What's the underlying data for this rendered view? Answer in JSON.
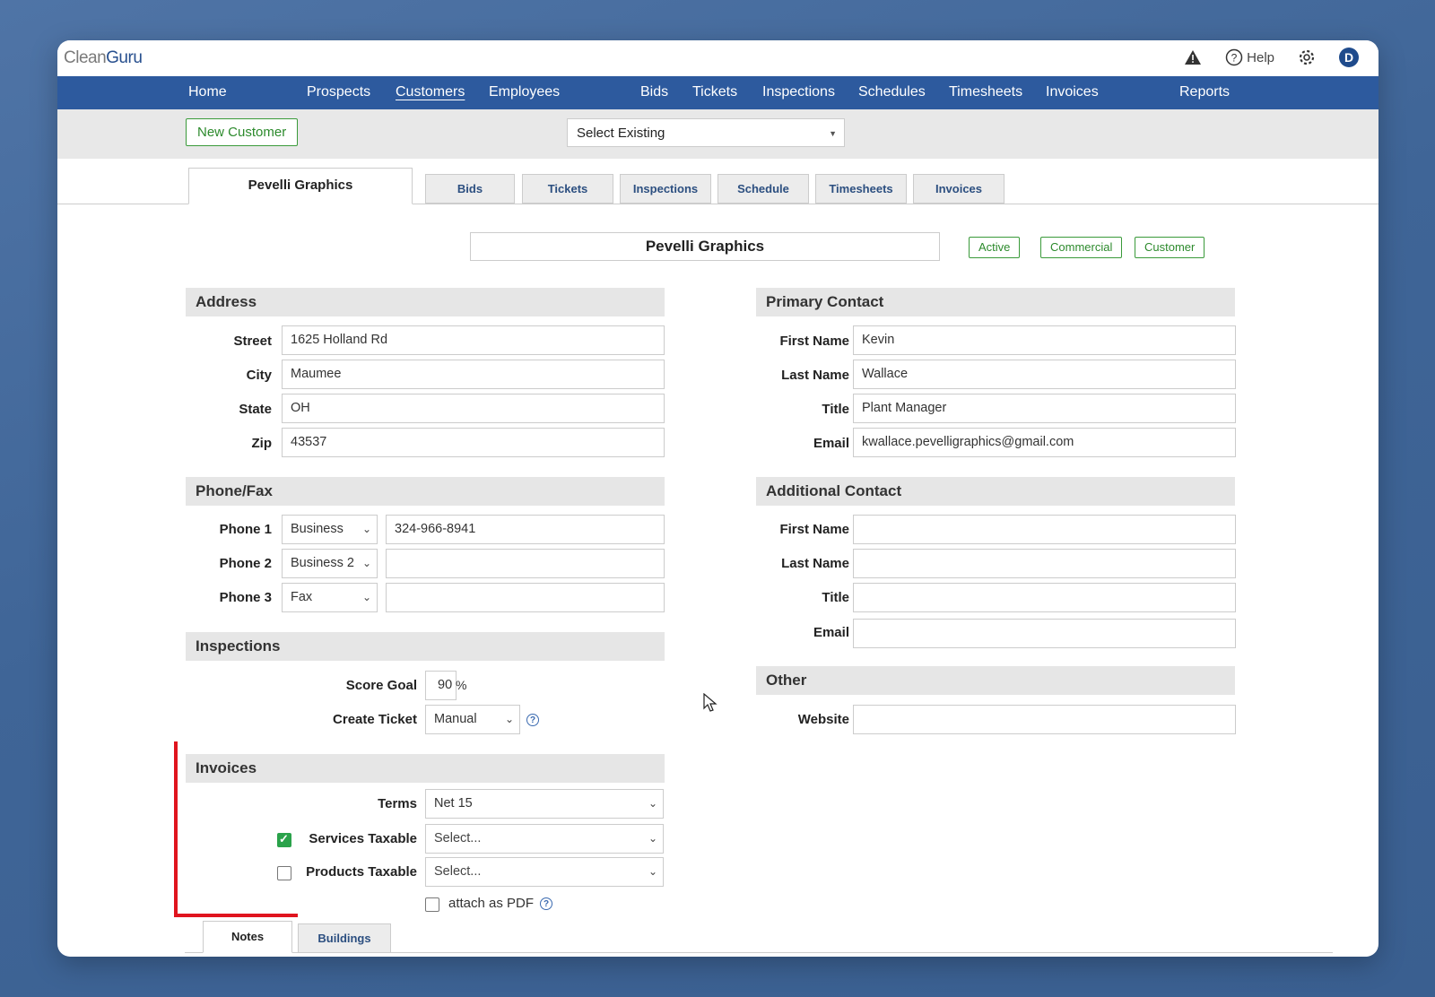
{
  "app": {
    "logo_clean": "Clean",
    "logo_guru": "Guru",
    "help_label": "Help",
    "user_initial": "D"
  },
  "nav": [
    "Home",
    "Prospects",
    "Customers",
    "Employees",
    "Bids",
    "Tickets",
    "Inspections",
    "Schedules",
    "Timesheets",
    "Invoices",
    "Reports"
  ],
  "nav_active": "Customers",
  "toolbar": {
    "new_customer": "New Customer",
    "select_existing": "Select Existing"
  },
  "tabs": {
    "main": "Pevelli Graphics",
    "others": [
      "Bids",
      "Tickets",
      "Inspections",
      "Schedule",
      "Timesheets",
      "Invoices"
    ]
  },
  "customer": {
    "name": "Pevelli Graphics",
    "badges": [
      "Active",
      "Commercial",
      "Customer"
    ]
  },
  "address": {
    "title": "Address",
    "street_label": "Street",
    "street": "1625 Holland Rd",
    "city_label": "City",
    "city": "Maumee",
    "state_label": "State",
    "state": "OH",
    "zip_label": "Zip",
    "zip": "43537"
  },
  "phone": {
    "title": "Phone/Fax",
    "p1_label": "Phone 1",
    "p1_type": "Business",
    "p1_value": "324-966-8941",
    "p2_label": "Phone 2",
    "p2_type": "Business 2",
    "p2_value": "",
    "p3_label": "Phone 3",
    "p3_type": "Fax",
    "p3_value": ""
  },
  "inspections": {
    "title": "Inspections",
    "score_label": "Score Goal",
    "score_value": "90",
    "score_unit": "%",
    "ticket_label": "Create Ticket",
    "ticket_value": "Manual"
  },
  "invoices": {
    "title": "Invoices",
    "terms_label": "Terms",
    "terms_value": "Net 15",
    "services_label": "Services Taxable",
    "services_checked": true,
    "services_value": "Select...",
    "products_label": "Products Taxable",
    "products_checked": false,
    "products_value": "Select...",
    "pdf_label": "attach as PDF",
    "pdf_checked": false
  },
  "primary_contact": {
    "title": "Primary Contact",
    "first_label": "First Name",
    "first": "Kevin",
    "last_label": "Last Name",
    "last": "Wallace",
    "title_label": "Title",
    "title_value": "Plant Manager",
    "email_label": "Email",
    "email": "kwallace.pevelligraphics@gmail.com"
  },
  "additional_contact": {
    "title": "Additional Contact",
    "first_label": "First Name",
    "first": "",
    "last_label": "Last Name",
    "last": "",
    "title_label": "Title",
    "title_value": "",
    "email_label": "Email",
    "email": ""
  },
  "other": {
    "title": "Other",
    "website_label": "Website",
    "website": ""
  },
  "bottom_tabs": [
    "Notes",
    "Buildings"
  ],
  "colors": {
    "nav": "#2d5a9e",
    "accent_green": "#2c8a2c",
    "annotation_red": "#e0141e"
  }
}
